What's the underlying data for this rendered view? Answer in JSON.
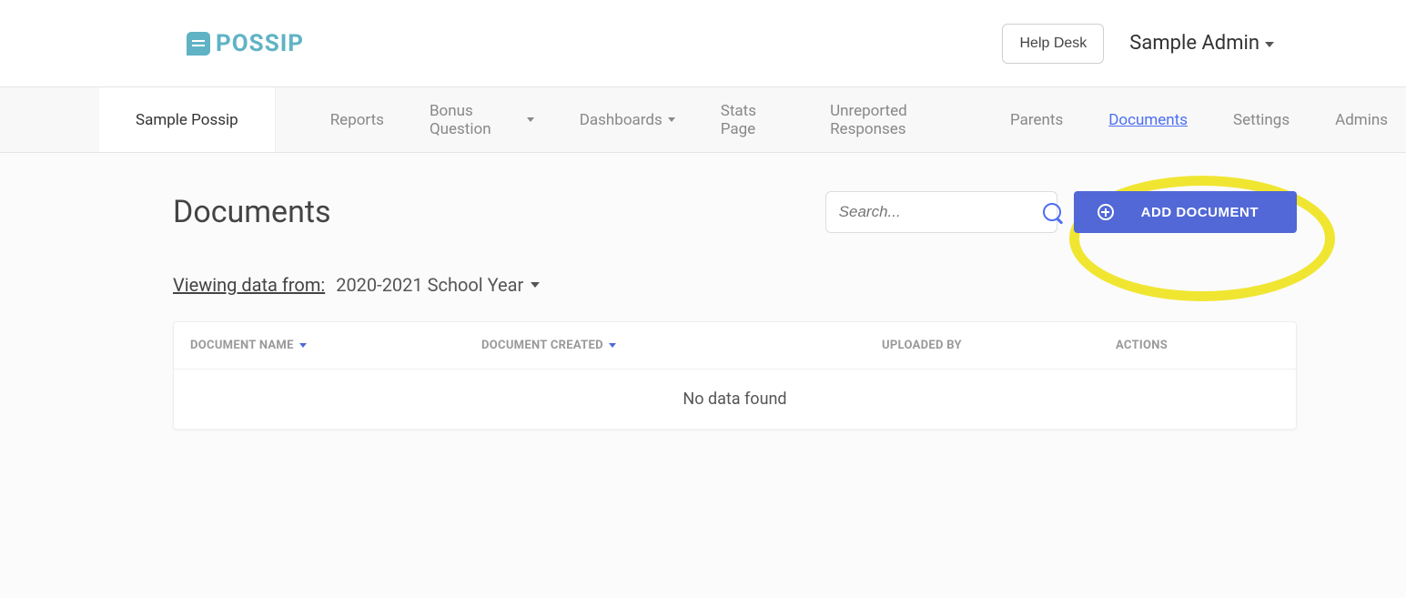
{
  "logo_text": "POSSIP",
  "header": {
    "help_desk": "Help Desk",
    "user_name": "Sample Admin"
  },
  "nav": {
    "brand": "Sample Possip",
    "items": [
      {
        "label": "Reports",
        "dropdown": false,
        "active": false
      },
      {
        "label": "Bonus Question",
        "dropdown": true,
        "active": false
      },
      {
        "label": "Dashboards",
        "dropdown": true,
        "active": false
      },
      {
        "label": "Stats Page",
        "dropdown": false,
        "active": false
      },
      {
        "label": "Unreported Responses",
        "dropdown": false,
        "active": false
      },
      {
        "label": "Parents",
        "dropdown": false,
        "active": false
      },
      {
        "label": "Documents",
        "dropdown": false,
        "active": true
      },
      {
        "label": "Settings",
        "dropdown": false,
        "active": false
      },
      {
        "label": "Admins",
        "dropdown": false,
        "active": false
      }
    ]
  },
  "page": {
    "title": "Documents",
    "search_placeholder": "Search...",
    "add_button": "ADD DOCUMENT"
  },
  "filter": {
    "label": "Viewing data from:",
    "value": "2020-2021 School Year"
  },
  "table": {
    "columns": {
      "name": "DOCUMENT NAME",
      "created": "DOCUMENT CREATED",
      "uploaded_by": "UPLOADED BY",
      "actions": "ACTIONS"
    },
    "empty_message": "No data found"
  }
}
